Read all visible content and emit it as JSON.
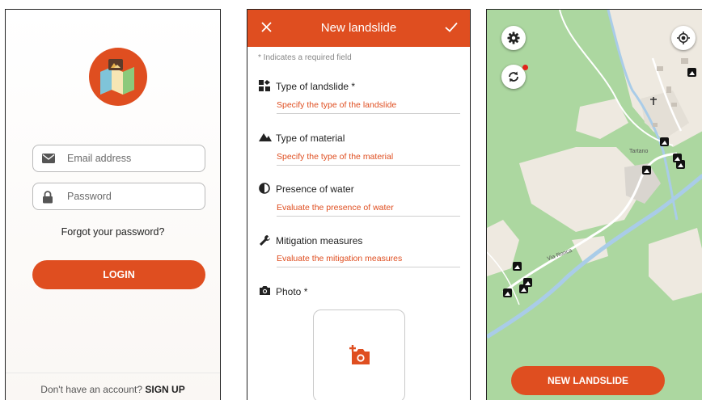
{
  "login": {
    "email_placeholder": "Email address",
    "password_placeholder": "Password",
    "forgot_label": "Forgot your password?",
    "login_label": "LOGIN",
    "signup_prompt": "Don't have an account?",
    "signup_label": "SIGN UP"
  },
  "form": {
    "title": "New landslide",
    "required_note": "* Indicates a required field",
    "sections": [
      {
        "label": "Type of landslide *",
        "placeholder": "Specify the type of the landslide",
        "icon": "blocks-icon"
      },
      {
        "label": "Type of material",
        "placeholder": "Specify the type of the material",
        "icon": "mountain-icon"
      },
      {
        "label": "Presence of water",
        "placeholder": "Evaluate the presence of water",
        "icon": "half-drop-icon"
      },
      {
        "label": "Mitigation measures",
        "placeholder": "Evaluate the mitigation measures",
        "icon": "wrench-icon"
      }
    ],
    "photo_label": "Photo *"
  },
  "map": {
    "place_label": "Tartano",
    "road_label": "Via Ronca",
    "new_button_label": "NEW LANDSLIDE"
  },
  "colors": {
    "accent": "#df4e20",
    "map_green": "#acd7a0",
    "map_land": "#eee9e0",
    "river": "#a9cce8",
    "badge_red": "#e2231a"
  }
}
